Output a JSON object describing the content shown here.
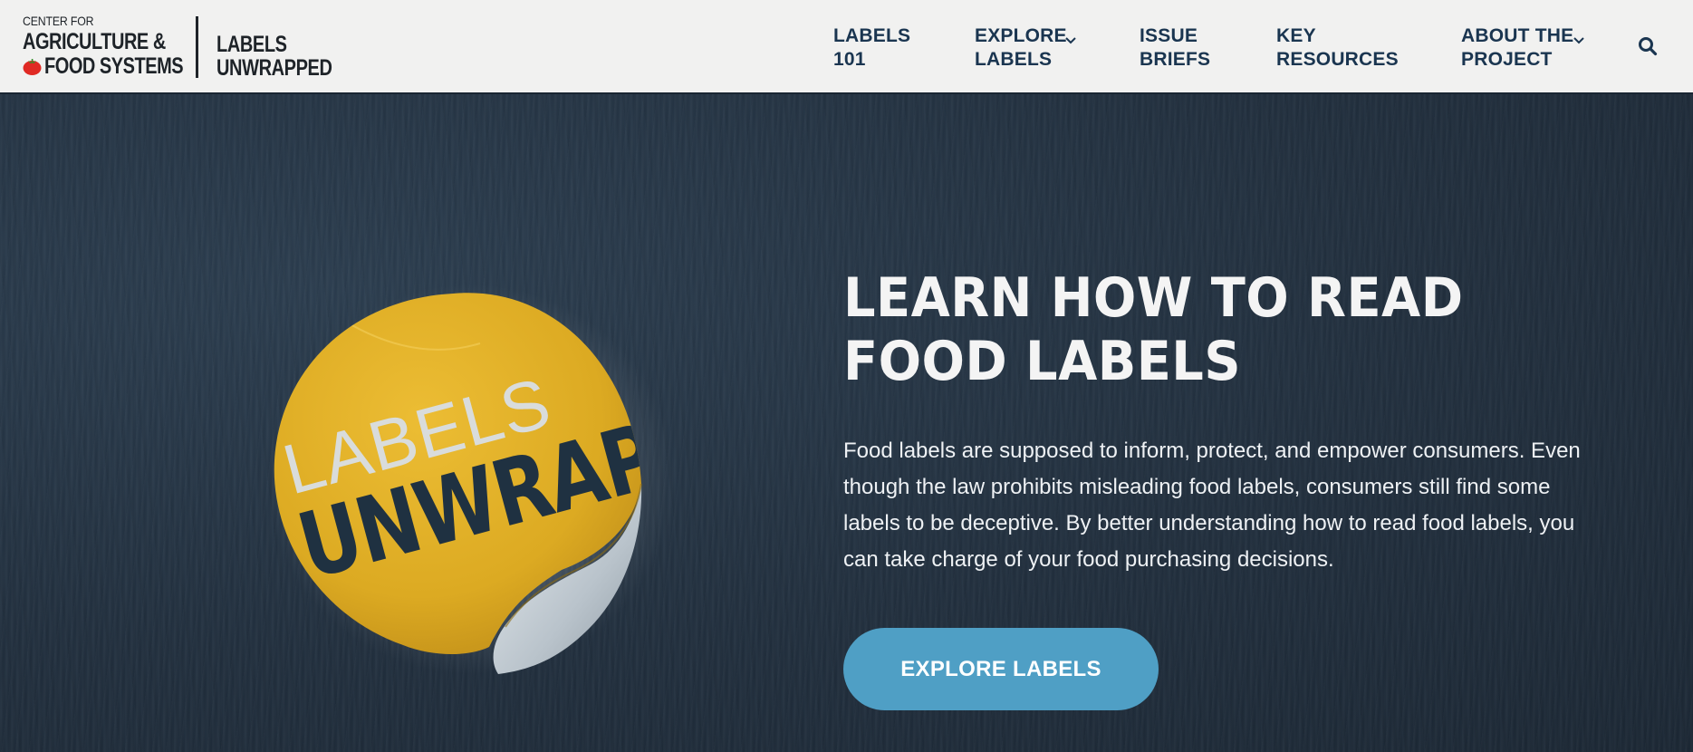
{
  "brand": {
    "org_line1": "CENTER FOR",
    "org_line2": "AGRICULTURE &",
    "org_line3": "FOOD SYSTEMS",
    "project_line1": "LABELS",
    "project_line2": "UNWRAPPED"
  },
  "nav": {
    "items": [
      {
        "label": "LABELS 101",
        "has_dropdown": false
      },
      {
        "label": "EXPLORE LABELS",
        "has_dropdown": true
      },
      {
        "label": "ISSUE BRIEFS",
        "has_dropdown": false
      },
      {
        "label": "KEY RESOURCES",
        "has_dropdown": false
      },
      {
        "label": "ABOUT THE PROJECT",
        "has_dropdown": true
      }
    ],
    "search_icon": "search-icon"
  },
  "hero": {
    "sticker_line1": "LABELS",
    "sticker_line2": "UNWRAPPED",
    "title": "LEARN HOW TO READ FOOD LABELS",
    "body": "Food labels are supposed to inform, protect, and empower consumers. Even though the law prohibits misleading food labels, consumers still find some labels to be deceptive. By better understanding how to read food labels, you can take charge of your food purchasing decisions.",
    "cta_label": "EXPLORE LABELS"
  },
  "colors": {
    "header_bg": "#f1f1f0",
    "nav_text": "#1a3550",
    "hero_bg": "#263444",
    "sticker_yellow": "#e1b12b",
    "cta_bg": "#4f9fc5",
    "text_light": "#f4f4f4"
  }
}
